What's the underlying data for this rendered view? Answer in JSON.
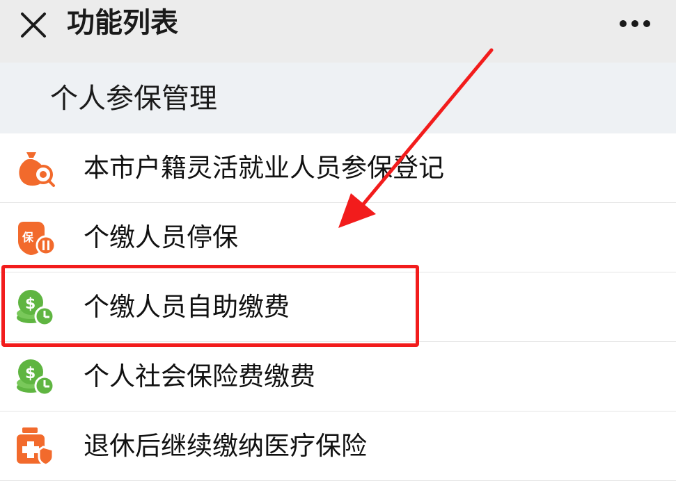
{
  "header": {
    "title": "功能列表",
    "close_icon": "close-icon",
    "more_icon": "more-icon"
  },
  "section": {
    "title": "个人参保管理"
  },
  "items": [
    {
      "label": "本市户籍灵活就业人员参保登记",
      "icon": "money-bag-search-icon",
      "color": "#f26a2c"
    },
    {
      "label": "个缴人员停保",
      "icon": "insurance-pause-icon",
      "color": "#f26a2c"
    },
    {
      "label": "个缴人员自助缴费",
      "icon": "coin-clock-icon",
      "color": "#5fb541",
      "highlighted": true
    },
    {
      "label": "个人社会保险费缴费",
      "icon": "coin-clock-icon",
      "color": "#5fb541"
    },
    {
      "label": "退休后继续缴纳医疗保险",
      "icon": "medical-kit-icon",
      "color": "#f26a2c"
    }
  ],
  "annotation": {
    "highlight_color": "#f21c1c",
    "arrow_color": "#f21c1c"
  }
}
